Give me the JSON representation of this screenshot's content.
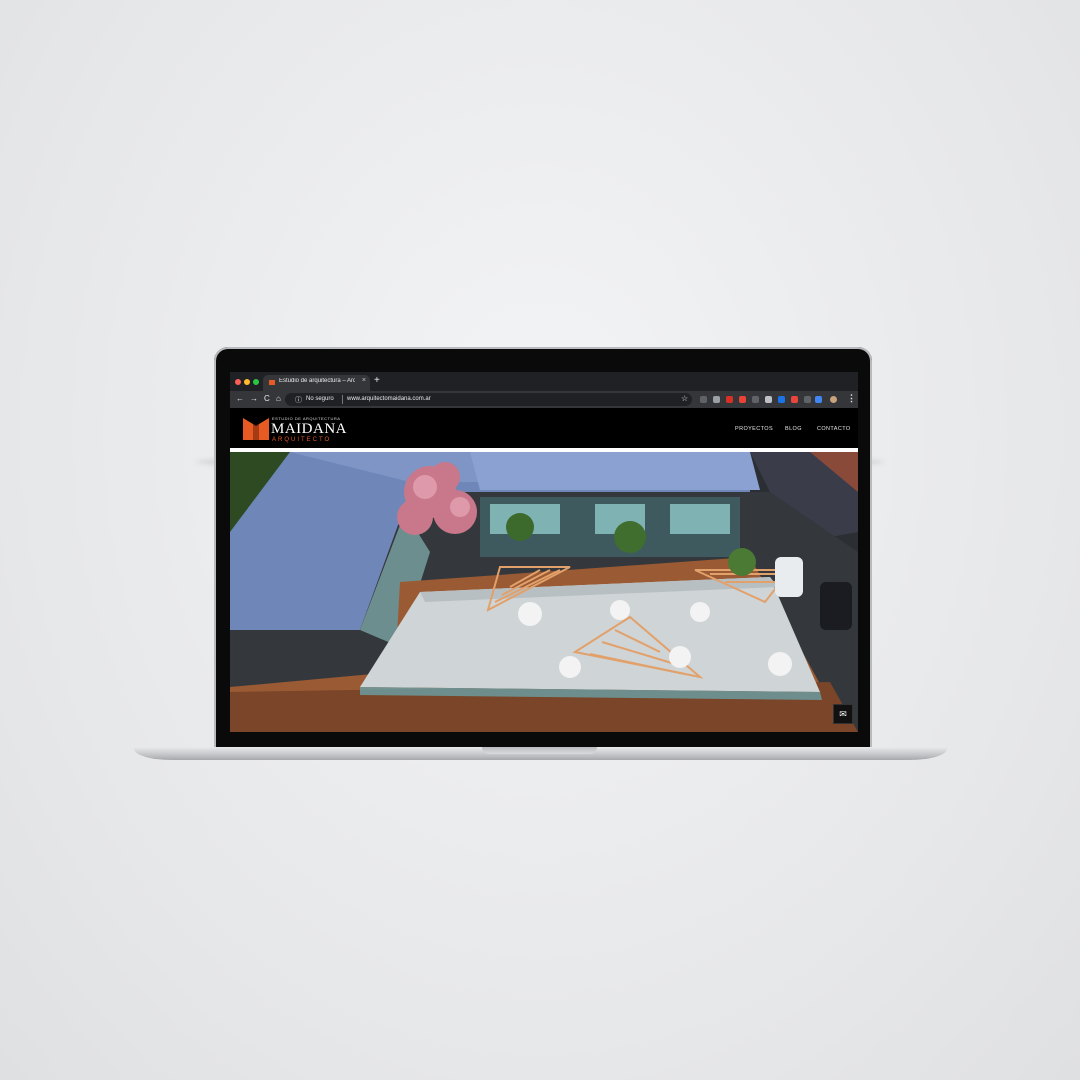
{
  "browser": {
    "tab_title": "Estudio de arquitectura – Arqu",
    "new_tab": "+",
    "tab_close": "×",
    "nav": {
      "back": "←",
      "forward": "→",
      "reload": "C",
      "home": "⌂"
    },
    "security_label": "No seguro",
    "url": "www.arquitectomaidana.com.ar",
    "menu": "⋮",
    "star": "☆"
  },
  "site": {
    "logo": {
      "top_line": "ESTUDIO DE ARQUITECTURA",
      "name": "MAIDANA",
      "sub": "ARQUITECTO"
    },
    "nav": [
      "PROYECTOS",
      "BLOG",
      "CONTACTO"
    ],
    "mail_icon": "✉"
  },
  "colors": {
    "accent": "#e85a23",
    "tab_bar": "#202124",
    "toolbar": "#35363a"
  }
}
